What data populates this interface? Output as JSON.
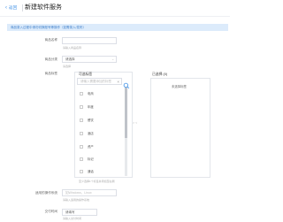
{
  "header": {
    "back_label": "返回",
    "title": "新建软件服务"
  },
  "notice": "商品录入过程中请勿切换账号等操作（如需录入/发布）",
  "form": {
    "name": {
      "label": "商品名称",
      "placeholder": "",
      "hint": "请输入商品名称"
    },
    "category": {
      "label": "商品分类",
      "value": "请选择",
      "hint": "请选择"
    },
    "tags": {
      "label": "商品标签"
    },
    "os": {
      "label": "适用的操作系统",
      "placeholder": "如Windows，Linux",
      "hint": "请输入适用的操作系统"
    },
    "time": {
      "label": "交付时间",
      "value": "请填写",
      "hint": "请输入交付时间"
    }
  },
  "tag_picker": {
    "left_title": "可选标签",
    "search_placeholder": "请输入需要添加的标签",
    "items": [
      "电商",
      "年度",
      "餐饮",
      "酒店",
      "资产",
      "标记",
      "通话"
    ],
    "arrow": "> <",
    "right_title": "已选择 (0)",
    "empty_text": "未选择标签",
    "hint": "至少选择1个标签并添加至右侧"
  }
}
